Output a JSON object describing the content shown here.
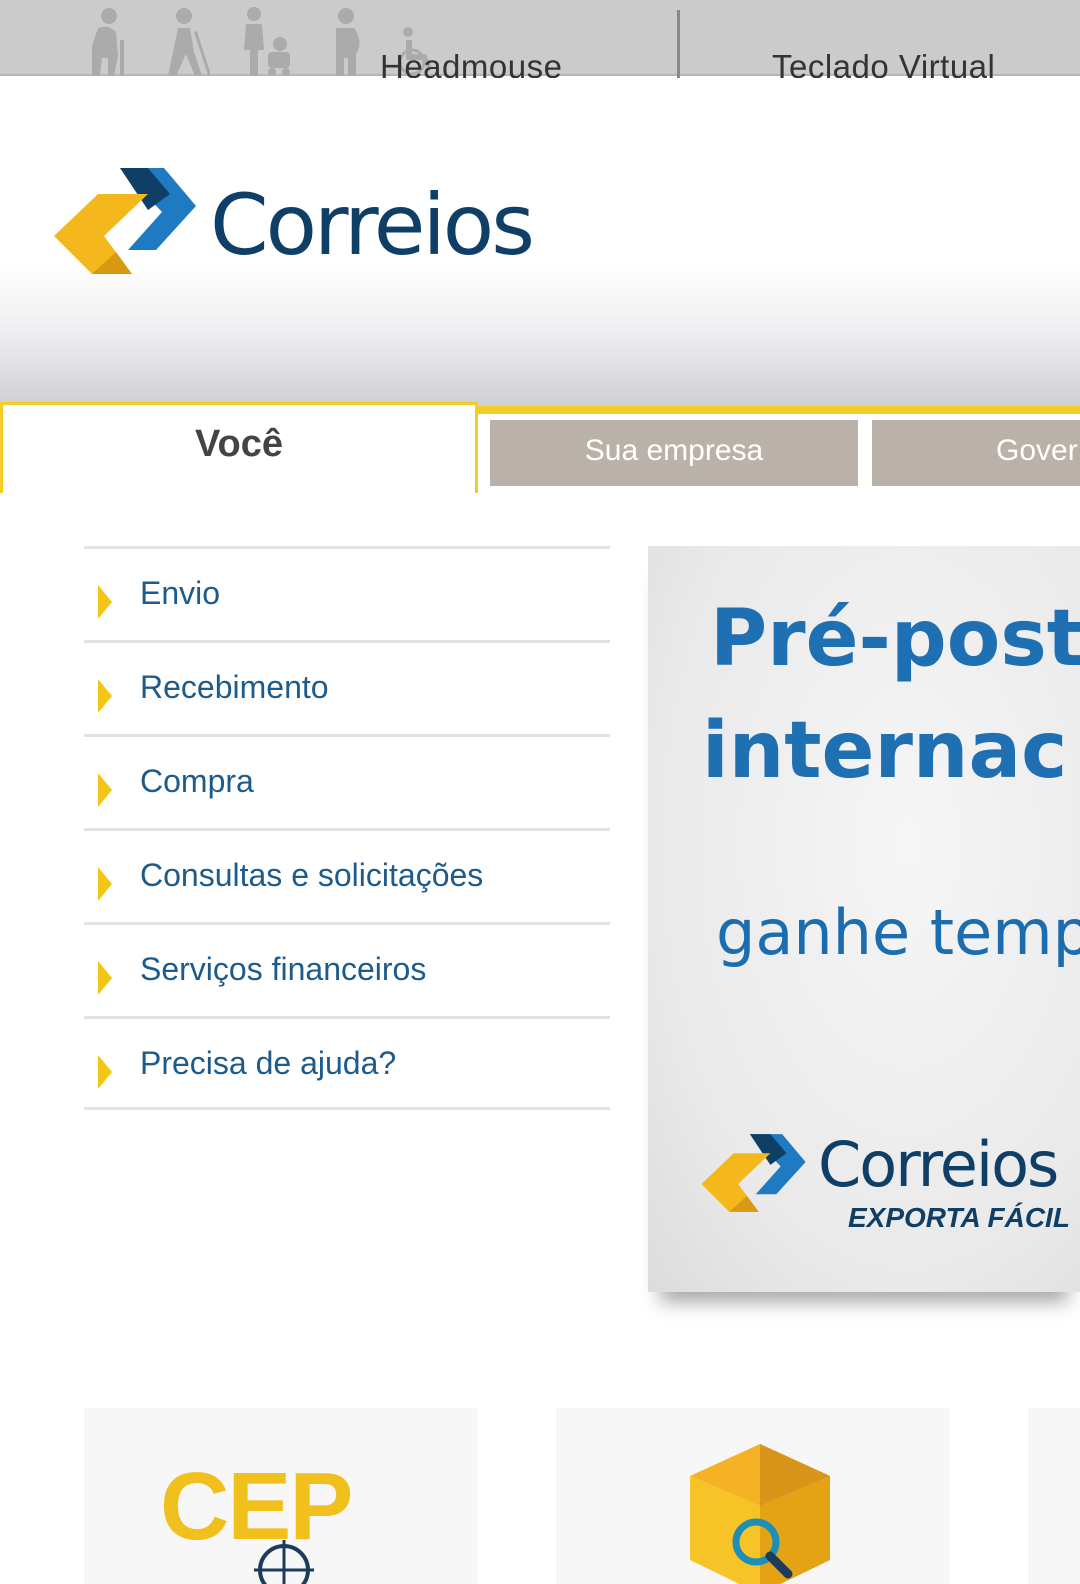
{
  "accessibility_bar": {
    "icons": [
      "elderly-person-icon",
      "blind-person-icon",
      "person-with-baby-icon",
      "pregnant-person-icon",
      "wheelchair-icon"
    ],
    "headmouse_label": "Headmouse",
    "virtual_keyboard_label": "Teclado Virtual"
  },
  "header": {
    "logo_text": "Correios",
    "brand_colors": {
      "yellow": "#f5b81c",
      "blue": "#0f3f66",
      "light_blue": "#1f7bc1"
    }
  },
  "tabs": [
    {
      "label": "Você",
      "active": true
    },
    {
      "label": "Sua empresa",
      "active": false
    },
    {
      "label": "Gover",
      "active": false
    }
  ],
  "menu": {
    "items": [
      {
        "label": "Envio"
      },
      {
        "label": "Recebimento"
      },
      {
        "label": "Compra"
      },
      {
        "label": "Consultas e solicitações"
      },
      {
        "label": "Serviços financeiros"
      },
      {
        "label": "Precisa de ajuda?"
      }
    ]
  },
  "banner": {
    "line1": "Pré-post",
    "line2": "internac",
    "line3": "ganhe temp",
    "logo_text": "Correios",
    "logo_sub": "EXPORTA FÁCIL"
  },
  "cards": [
    {
      "text": "CEP",
      "icon": "crosshair-icon"
    },
    {
      "icon": "package-search-icon"
    }
  ]
}
